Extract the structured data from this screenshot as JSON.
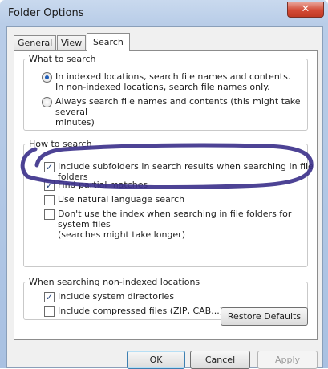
{
  "window": {
    "title": "Folder Options",
    "close_glyph": "✕"
  },
  "tabs": [
    {
      "label": "General",
      "active": false
    },
    {
      "label": "View",
      "active": false
    },
    {
      "label": "Search",
      "active": true
    }
  ],
  "what_to_search": {
    "legend": "What to search",
    "options": [
      {
        "line1": "In indexed locations, search file names and contents.",
        "line2": "In non-indexed locations, search file names only.",
        "selected": true
      },
      {
        "line1": "Always search file names and contents (this might take several",
        "line2": "minutes)",
        "selected": false
      }
    ]
  },
  "how_to_search": {
    "legend": "How to search",
    "options": [
      {
        "line1": "Include subfolders in search results when searching in file folders",
        "checked": true
      },
      {
        "line1": "Find partial matches",
        "checked": true
      },
      {
        "line1": "Use natural language search",
        "checked": false
      },
      {
        "line1": "Don't use the index when searching in file folders for system files",
        "line2": "(searches might take longer)",
        "checked": false
      }
    ]
  },
  "non_indexed": {
    "legend": "When searching non-indexed locations",
    "options": [
      {
        "line1": "Include system directories",
        "checked": true
      },
      {
        "line1": "Include compressed files (ZIP, CAB...)",
        "checked": false
      }
    ]
  },
  "buttons": {
    "restore_defaults": "Restore Defaults",
    "ok": "OK",
    "cancel": "Cancel",
    "apply": "Apply"
  },
  "colors": {
    "annotation_ink": "#3a2f8a",
    "check_mark": "#1f3f7a"
  },
  "check_glyph": "✓"
}
